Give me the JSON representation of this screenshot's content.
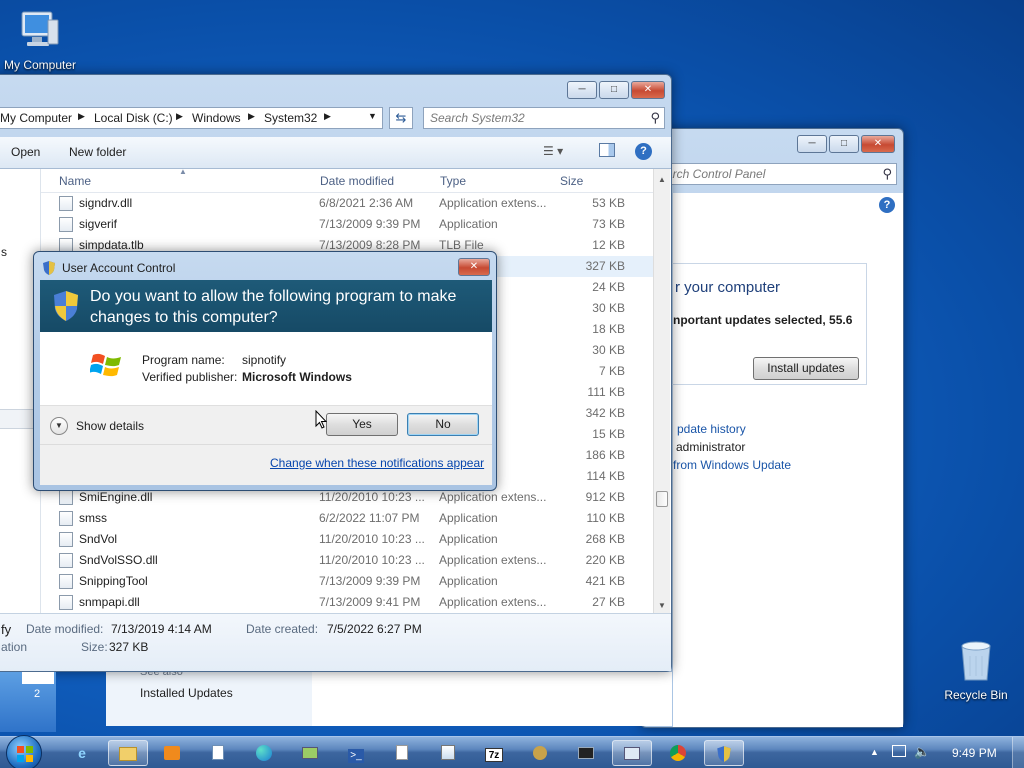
{
  "desktop": {
    "my_computer": "My Computer",
    "recycle_bin": "Recycle Bin"
  },
  "explorer": {
    "breadcrumb": [
      "My Computer",
      "Local Disk (C:)",
      "Windows",
      "System32"
    ],
    "search_placeholder": "Search System32",
    "toolbar": {
      "open": "Open",
      "new_folder": "New folder"
    },
    "columns": {
      "name": "Name",
      "date": "Date modified",
      "type": "Type",
      "size": "Size"
    },
    "rows": [
      {
        "name": "signdrv.dll",
        "date": "6/8/2021 2:36 AM",
        "type": "Application extens...",
        "size": "53 KB"
      },
      {
        "name": "sigverif",
        "date": "7/13/2009 9:39 PM",
        "type": "Application",
        "size": "73 KB"
      },
      {
        "name": "simpdata.tlb",
        "date": "7/13/2009 8:28 PM",
        "type": "TLB File",
        "size": "12 KB"
      },
      {
        "name": "",
        "date": "",
        "type": "",
        "size": "327 KB"
      },
      {
        "name": "",
        "date": "",
        "type": "extens...",
        "size": "24 KB"
      },
      {
        "name": "",
        "date": "",
        "type": "extens...",
        "size": "30 KB"
      },
      {
        "name": "",
        "date": "",
        "type": "extens...",
        "size": "18 KB"
      },
      {
        "name": "",
        "date": "",
        "type": "extens...",
        "size": "30 KB"
      },
      {
        "name": "",
        "date": "",
        "type": "extens...",
        "size": "7 KB"
      },
      {
        "name": "",
        "date": "",
        "type": "ript File",
        "size": "111 KB"
      },
      {
        "name": "",
        "date": "",
        "type": "",
        "size": "342 KB"
      },
      {
        "name": "",
        "date": "",
        "type": "extens...",
        "size": "15 KB"
      },
      {
        "name": "",
        "date": "",
        "type": "extens...",
        "size": "186 KB"
      },
      {
        "name": "",
        "date": "",
        "type": "extens...",
        "size": "114 KB"
      },
      {
        "name": "SmiEngine.dll",
        "date": "11/20/2010 10:23 ...",
        "type": "Application extens...",
        "size": "912 KB"
      },
      {
        "name": "smss",
        "date": "6/2/2022 11:07 PM",
        "type": "Application",
        "size": "110 KB"
      },
      {
        "name": "SndVol",
        "date": "11/20/2010 10:23 ...",
        "type": "Application",
        "size": "268 KB"
      },
      {
        "name": "SndVolSSO.dll",
        "date": "11/20/2010 10:23 ...",
        "type": "Application extens...",
        "size": "220 KB"
      },
      {
        "name": "SnippingTool",
        "date": "7/13/2009 9:39 PM",
        "type": "Application",
        "size": "421 KB"
      },
      {
        "name": "snmpapi.dll",
        "date": "7/13/2009 9:41 PM",
        "type": "Application extens...",
        "size": "27 KB"
      }
    ],
    "left_fragment": "s",
    "details": {
      "name_fragment": "fy",
      "type_fragment": "ation",
      "date_modified_label": "Date modified:",
      "date_modified": "7/13/2019 4:14 AM",
      "date_created_label": "Date created:",
      "date_created": "7/5/2022 6:27 PM",
      "size_label": "Size:",
      "size": "327 KB"
    }
  },
  "control_panel": {
    "search_placeholder": "arch Control Panel",
    "heading": "r your computer",
    "updates_text": "nportant updates selected, 55.6",
    "install_button": "Install updates",
    "link_history": "pdate history",
    "admin_text": "administrator",
    "link_windows_update": "from Windows Update",
    "see_also": "See also",
    "installed_updates": "Installed Updates"
  },
  "uac": {
    "title": "User Account Control",
    "question": "Do you want to allow the following program to make changes to this computer?",
    "program_label": "Program name:",
    "program_name": "sipnotify",
    "publisher_label": "Verified publisher:",
    "publisher": "Microsoft Windows",
    "show_details": "Show details",
    "yes": "Yes",
    "no": "No",
    "change_link": "Change when these notifications appear"
  },
  "taskbar": {
    "clock": "9:49 PM",
    "page_number": "2",
    "items_7z": "7z"
  }
}
